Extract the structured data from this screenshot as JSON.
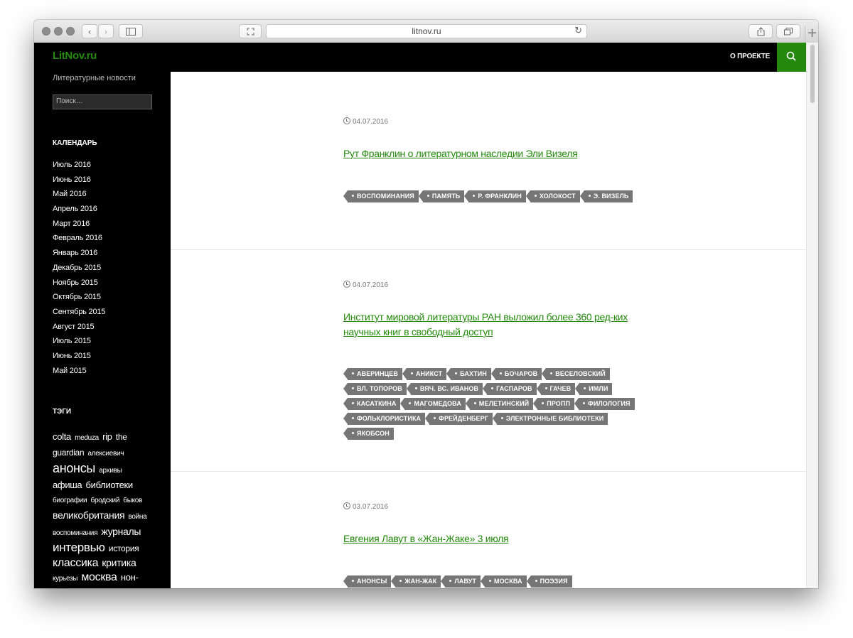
{
  "browser": {
    "url": "litnov.ru",
    "new_tab_label": "+"
  },
  "header": {
    "site_title": "LitNov.ru",
    "nav_about": "О ПРОЕКТЕ"
  },
  "sidebar": {
    "tagline": "Литературные новости",
    "search_placeholder": "Поиск…",
    "calendar_title": "КАЛЕНДАРЬ",
    "archives": [
      "Июль 2016",
      "Июнь 2016",
      "Май 2016",
      "Апрель 2016",
      "Март 2016",
      "Февраль 2016",
      "Январь 2016",
      "Декабрь 2015",
      "Ноябрь 2015",
      "Октябрь 2015",
      "Сентябрь 2015",
      "Август 2015",
      "Июль 2015",
      "Июнь 2015",
      "Май 2015"
    ],
    "tags_title": "ТЭГИ",
    "tag_cloud": [
      {
        "text": "colta",
        "size": 13
      },
      {
        "text": "meduza",
        "size": 10
      },
      {
        "text": "rip",
        "size": 13
      },
      {
        "text": "the guardian",
        "size": 12
      },
      {
        "text": "алексиевич",
        "size": 10
      },
      {
        "text": "анонсы",
        "size": 18
      },
      {
        "text": "архивы",
        "size": 10
      },
      {
        "text": "афиша",
        "size": 13
      },
      {
        "text": "библиотеки",
        "size": 13
      },
      {
        "text": "биографии",
        "size": 10
      },
      {
        "text": "бродский",
        "size": 10
      },
      {
        "text": "быков",
        "size": 10
      },
      {
        "text": "великобритания",
        "size": 14
      },
      {
        "text": "война",
        "size": 10
      },
      {
        "text": "воспоминания",
        "size": 10
      },
      {
        "text": "журналы",
        "size": 14
      },
      {
        "text": "интервью",
        "size": 17
      },
      {
        "text": "история",
        "size": 12
      },
      {
        "text": "классика",
        "size": 16
      },
      {
        "text": "критика",
        "size": 14
      },
      {
        "text": "курьезы",
        "size": 10
      },
      {
        "text": "москва",
        "size": 16
      },
      {
        "text": "нон-",
        "size": 13
      }
    ]
  },
  "posts": [
    {
      "date": "04.07.2016",
      "title": "Рут Франклин о литературном наследии Эли Визеля",
      "tags": [
        "ВОСПОМИНАНИЯ",
        "ПАМЯТЬ",
        "Р. ФРАНКЛИН",
        "ХОЛОКОСТ",
        "Э. ВИЗЕЛЬ"
      ]
    },
    {
      "date": "04.07.2016",
      "title": "Институт мировой литературы РАН выложил более 360 ред-ких научных книг в свободный доступ",
      "tags": [
        "АВЕРИНЦЕВ",
        "АНИКСТ",
        "БАХТИН",
        "БОЧАРОВ",
        "ВЕСЕЛОВСКИЙ",
        "ВЛ. ТОПОРОВ",
        "ВЯЧ. ВС. ИВАНОВ",
        "ГАСПАРОВ",
        "ГАЧЕВ",
        "ИМЛИ",
        "КАСАТКИНА",
        "МАГОМЕДОВА",
        "МЕЛЕТИНСКИЙ",
        "ПРОПП",
        "ФИЛОЛОГИЯ",
        "ФОЛЬКЛОРИСТИКА",
        "ФРЕЙДЕНБЕРГ",
        "ЭЛЕКТРОННЫЕ БИБЛИОТЕКИ",
        "ЯКОБСОН"
      ]
    },
    {
      "date": "03.07.2016",
      "title": "Евгения Лавут в «Жан-Жаке» 3 июля",
      "tags": [
        "АНОНСЫ",
        "ЖАН-ЖАК",
        "ЛАВУТ",
        "МОСКВА",
        "ПОЭЗИЯ"
      ]
    }
  ]
}
